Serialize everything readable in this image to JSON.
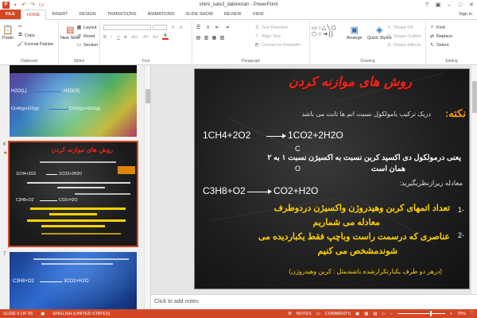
{
  "window": {
    "title": "shimi_sale3_dabirestan - PowerPoint",
    "signin": "Sign in",
    "app_logo": "P"
  },
  "tabs": [
    "FILE",
    "HOME",
    "INSERT",
    "DESIGN",
    "TRANSITIONS",
    "ANIMATIONS",
    "SLIDE SHOW",
    "REVIEW",
    "VIEW"
  ],
  "active_tab": "HOME",
  "ribbon": {
    "clipboard": {
      "paste": "Paste",
      "cut": "",
      "copy": "Copy",
      "format_painter": "Format Painter",
      "label": "Clipboard"
    },
    "slides": {
      "new_slide": "New Slide",
      "layout": "Layout",
      "reset": "Reset",
      "section": "Section",
      "label": "Slides"
    },
    "font": {
      "bold": "B",
      "italic": "I",
      "underline": "U",
      "strike": "S",
      "shadow": "abc",
      "spacing": "AV",
      "case": "Aa",
      "font_color": "A",
      "label": "Font"
    },
    "paragraph": {
      "text_direction": "Text Direction",
      "align_text": "Align Text",
      "smartart": "Convert to SmartArt",
      "label": "Paragraph"
    },
    "drawing": {
      "shapes": "Shapes",
      "arrange": "Arrange",
      "quick_styles": "Quick Styles",
      "shape_fill": "Shape Fill",
      "shape_outline": "Shape Outline",
      "shape_effects": "Shape Effects",
      "label": "Drawing"
    },
    "editing": {
      "find": "Find",
      "replace": "Replace",
      "select": "Select",
      "label": "Editing"
    }
  },
  "thumbnails": [
    {
      "number": "",
      "lines": [
        "H2O(L)",
        "H2O(S)",
        "CH4(g)+O2(g)",
        "CO2(g)+H2O(g)"
      ]
    },
    {
      "number": "6",
      "title": "روش های موازنه کردن",
      "lines": [
        "1CH4+2O2",
        "1CO2+2H2O",
        "C3H8+O2",
        "CO2+H2O"
      ]
    },
    {
      "number": "7",
      "lines": [
        "C3H8+O2",
        "3CO2+H2O"
      ]
    }
  ],
  "slide": {
    "title": "روش های موازنه کردن",
    "note_label": "نکته:",
    "intro": "دریک ترکیب بامولکول نسبت اتم ها ثابت می باشد",
    "eq1_left": "1CH4+2O2",
    "eq1_right": "1CO2+2H2O",
    "label_c": "C",
    "label_o": "O",
    "ratio_line1": "یعنی درمولکول دی اکسید کربن نسبت به اکسیژن نسبت ۱ به ۲",
    "ratio_line2": "همان است",
    "eq_intro": "معادله زیرازنظربگیرید:",
    "eq2_left": "C3H8+O2",
    "eq2_right": "CO2+H2O",
    "step1_num": "1-",
    "step1_a": "تعداد اتمهای کربن وهیدروژن واکسیژن دردوطرف",
    "step1_b": "معادله می شماریم",
    "step2_num": "2-",
    "step2_a": "عناصری که درسمت راست وباچپ فقط یکباردیده می",
    "step2_b": "شوندمشخص می کنیم",
    "footnote": "(درهر دو طرف یکبارتکرارشده باشندمثل : کربن وهیدروژن)"
  },
  "notes_placeholder": "Click to add notes",
  "status": {
    "slide_info": "SLIDE 6 OF 65",
    "language": "ENGLISH (UNITED STATES)",
    "notes": "NOTES",
    "comments": "COMMENTS",
    "zoom": "70%",
    "zoom_level": 0.7
  },
  "colors": {
    "accent": "#d24726",
    "title_red": "#e8281e",
    "note_orange": "#ff9900",
    "yellow": "#ffd200",
    "white": "#ffffff"
  }
}
